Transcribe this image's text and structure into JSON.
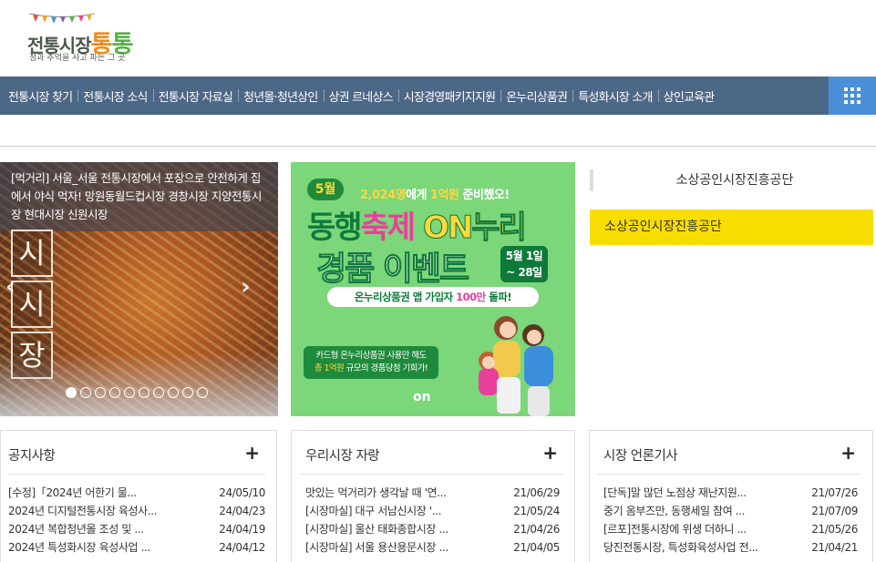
{
  "logo": {
    "text_a": "전통시장",
    "text_b": "통",
    "text_c": "통",
    "tagline": "정과 추억을 사고 파는 그 곳"
  },
  "nav": {
    "items": [
      "전통시장 찾기",
      "전통시장 소식",
      "전통시장 자료실",
      "청년몰·청년상인",
      "상권 르네상스",
      "시장경영패키지지원",
      "온누리상품권",
      "특성화시장 소개",
      "상인교육관"
    ],
    "menu_icon": "grid-menu-icon"
  },
  "slider": {
    "caption": "[먹거리] 서울_서울 전통시장에서 포장으로 안전하게 집에서 야식 먹자! 망원동월드컵시장 경창시장 지양전통시장 현대시장 신원시장",
    "sign": [
      "시",
      "시",
      "장"
    ],
    "prev": "‹",
    "next": "›",
    "dots_total": 10,
    "dots_active": 1
  },
  "banner": {
    "month": "5월",
    "top_a": "2,024명",
    "top_b": "에게 ",
    "top_c": "1억원",
    "top_d": " 준비했오!",
    "title_a": "동행",
    "title_b": "축제 ",
    "title_c": "ON누리",
    "title2": "경품 이벤트",
    "date_a": "5월 1일",
    "date_b": "~ 28일",
    "pill_a": "온누리상품권 앱 가입자 ",
    "pill_b": "100만",
    "pill_c": " 돌파!",
    "note_a": "카드형 온누리상품권 사용만 해도",
    "note_b": "총 1억원",
    "note_c": " 규모의 경품당첨 기회가!",
    "logo_text": "on"
  },
  "org": {
    "label": "소상공인시장진흥공단",
    "link": "소상공인시장진흥공단"
  },
  "boards": [
    {
      "title": "공지사항",
      "more": "+",
      "items": [
        {
          "title": "[수정]「2024년 어한기 물...",
          "date": "24/05/10"
        },
        {
          "title": "2024년 디지털전통시장 육성사...",
          "date": "24/04/23"
        },
        {
          "title": "2024년 복합청년몰 조성 및 ...",
          "date": "24/04/19"
        },
        {
          "title": "2024년 특성화시장 육성사업 ...",
          "date": "24/04/12"
        }
      ]
    },
    {
      "title": "우리시장 자랑",
      "more": "+",
      "items": [
        {
          "title": "맛있는 먹거리가 생각날 때 '연...",
          "date": "21/06/29"
        },
        {
          "title": "[시장마실] 대구 서남신시장 '...",
          "date": "21/05/24"
        },
        {
          "title": "[시장마실] 울산 태화종합시장 ...",
          "date": "21/04/26"
        },
        {
          "title": "[시장마실] 서울 용산용문시장 ...",
          "date": "21/04/05"
        }
      ]
    },
    {
      "title": "시장 언론기사",
      "more": "+",
      "items": [
        {
          "title": "[단독]말 많던 노점상 재난지원...",
          "date": "21/07/26"
        },
        {
          "title": "중기 옴부즈만, 동행세일 참여 ...",
          "date": "21/07/09"
        },
        {
          "title": "[르포]전통시장에 위생 더하니 ...",
          "date": "21/05/26"
        },
        {
          "title": "당진전통시장, 특성화육성사업 전...",
          "date": "21/04/21"
        }
      ]
    }
  ]
}
